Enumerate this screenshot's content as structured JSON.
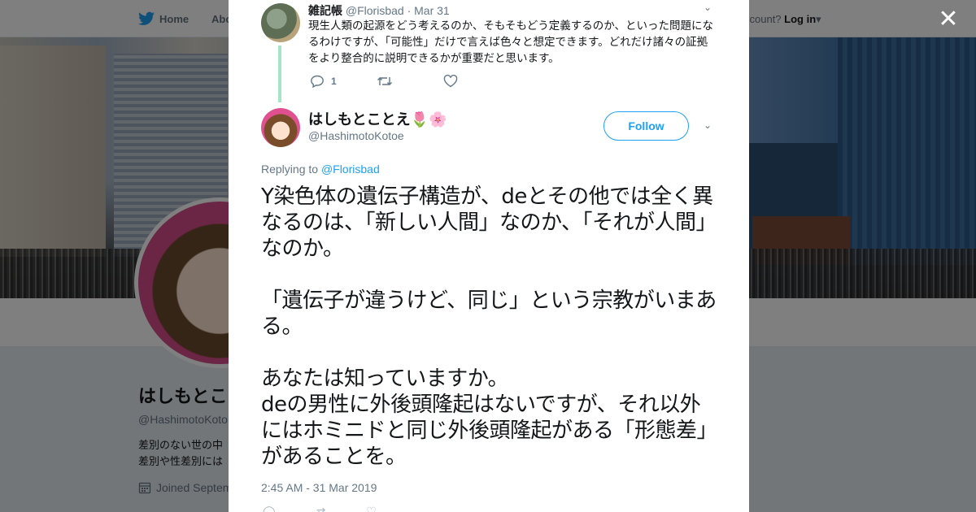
{
  "nav": {
    "home_label": "Home",
    "about_label": "Abo",
    "account_prompt": "ccount?",
    "login_label": "Log in"
  },
  "profile": {
    "name": "はしもとこ",
    "handle": "@HashimotoKoto",
    "bio_line1": "差別のない世の中",
    "bio_line2": "差別や性差別には",
    "joined": "Joined Septem"
  },
  "parent_tweet": {
    "name": "雑記帳",
    "handle": "@Florisbad",
    "date": "· Mar 31",
    "text": "現生人類の起源をどう考えるのか、そもそもどう定義するのか、といった問題になるわけですが、「可能性」だけで言えば色々と想定できます。どれだけ諸々の証拠をより整合的に説明できるかが重要だと思います。",
    "reply_count": "1"
  },
  "main_tweet": {
    "name": "はしもとことえ🌷🌸",
    "handle": "@HashimotoKotoe",
    "follow_label": "Follow",
    "replying_prefix": "Replying to",
    "replying_to": "@Florisbad",
    "para1": "Y染色体の遺伝子構造が、deとその他では全く異なるのは、「新しい人間」なのか、「それが人間」なのか。",
    "para2": "「遺伝子が違うけど、同じ」という宗教がいまある。",
    "para3a": "あなたは知っていますか。",
    "para3b": "deの男性に外後頭隆起はないですが、それ以外にはホミニドと同じ外後頭隆起がある「形態差」があることを。",
    "timestamp": "2:45 AM - 31 Mar 2019"
  },
  "icons": [
    "twitter-bird-icon",
    "caret-down-icon",
    "close-icon",
    "chevron-down-icon",
    "reply-icon",
    "retweet-icon",
    "like-icon",
    "calendar-icon"
  ],
  "colors": {
    "accent": "#1da1f2",
    "thread_line": "#a6e5c8",
    "text": "#14171a",
    "muted": "#657786"
  }
}
